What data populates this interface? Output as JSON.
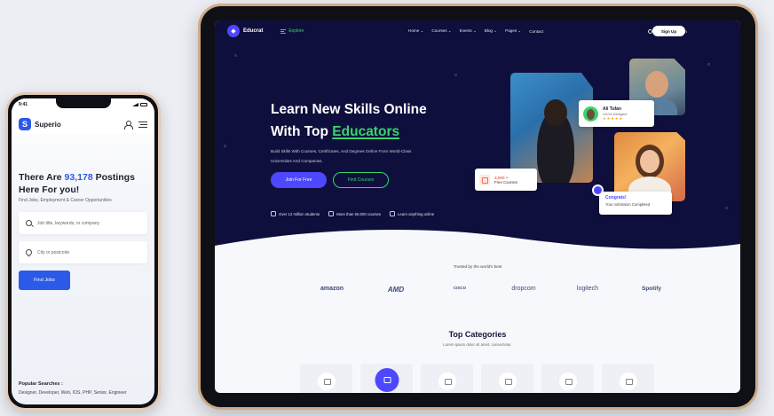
{
  "phone": {
    "time": "9:41",
    "brand": "Superio",
    "logo_letter": "S",
    "hero_prefix": "There Are ",
    "hero_count": "93,178",
    "hero_suffix": " Postings Here For you!",
    "subtitle": "Find Jobs, Employment & Career Opportunities",
    "keyword_placeholder": "Job title, keywords, or company",
    "location_placeholder": "City or postcode",
    "find_button": "Find Jobs",
    "popular_title": "Popular Searches :",
    "popular_list": "Designer, Developer, Web, IOS, PHP, Senior, Engineer"
  },
  "tablet": {
    "brand": "Educrat",
    "explore": "Explore",
    "nav": [
      "Home ⌄",
      "Courses ⌄",
      "Events ⌄",
      "Blog ⌄",
      "Pages ⌄",
      "Contact"
    ],
    "login": "Log In",
    "signup": "Sign Up",
    "hero_line1": "Learn New Skills Online",
    "hero_line2_prefix": "With Top ",
    "hero_line2_accent": "Educators",
    "hero_desc": "Build Skills With Courses, Certificates, And Degrees Online From World-Class Universities And Companies.",
    "join_button": "Join For Free",
    "find_courses_button": "Find Courses",
    "features": [
      "Over 12 million students",
      "More than 60,000 courses",
      "Learn anything online"
    ],
    "instructor_name": "Ali Tufan",
    "instructor_role": "UX/UI Designer",
    "instructor_stars": "★★★★★",
    "courses_count": "3,000 +",
    "courses_label": "Free Courses",
    "congrats_title": "Congrats!",
    "congrats_sub": "Your Admission Completed",
    "trusted": "Trusted by the world's best",
    "logos": [
      "amazon",
      "AMD",
      "CISCO",
      "dropcom",
      "logitech",
      "Spotify"
    ],
    "categories_title": "Top Categories",
    "categories_sub": "Lorem ipsum dolor sit amet, consectetur."
  },
  "colors": {
    "phone_accent": "#2b59e8",
    "hero_bg": "#0f0f3d",
    "primary": "#4d48ff",
    "green_accent": "#37d56b"
  }
}
